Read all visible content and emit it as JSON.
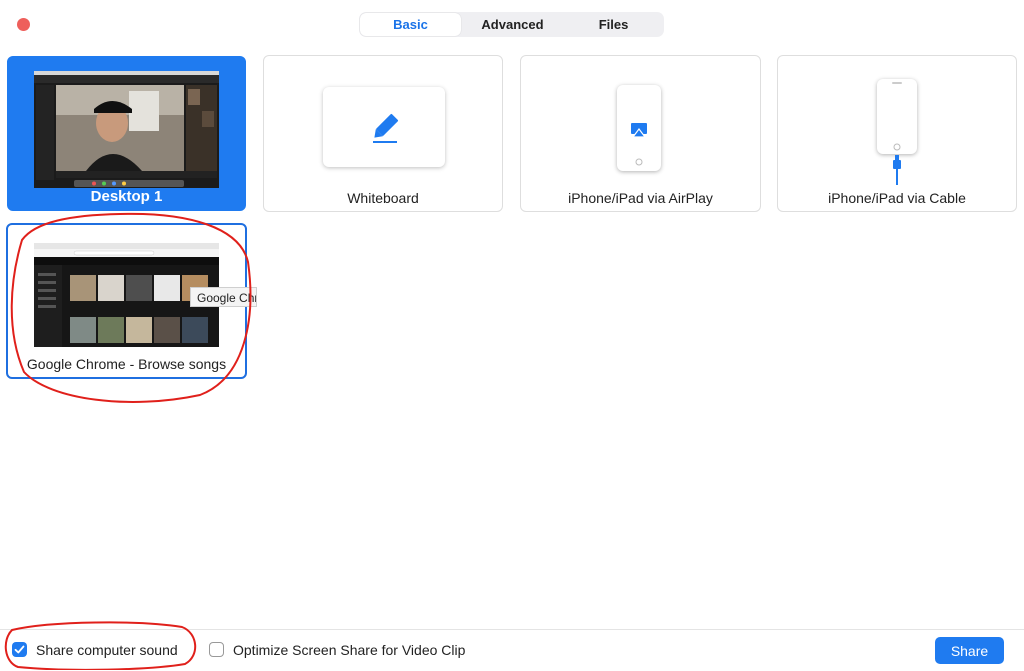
{
  "tabs": {
    "basic": "Basic",
    "advanced": "Advanced",
    "files": "Files",
    "active": "Basic"
  },
  "cards": {
    "desktop": "Desktop 1",
    "whiteboard": "Whiteboard",
    "airplay": "iPhone/iPad via AirPlay",
    "cable": "iPhone/iPad via Cable",
    "chrome": "Google Chrome - Browse songs"
  },
  "tooltip": "Google Chr",
  "footer": {
    "share_sound": "Share computer sound",
    "share_sound_checked": true,
    "optimize": "Optimize Screen Share for Video Clip",
    "optimize_checked": false,
    "share_button": "Share"
  },
  "colors": {
    "accent": "#1f7bf0",
    "close": "#ee5f5b",
    "annotation": "#e0201b"
  }
}
